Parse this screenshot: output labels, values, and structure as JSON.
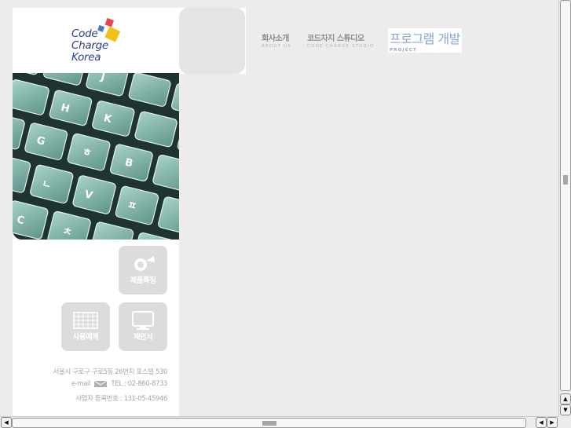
{
  "logo": {
    "lines": [
      "Code",
      "Charge",
      "Korea"
    ]
  },
  "nav": [
    {
      "ko": "회사소개",
      "en": "ABOUT US",
      "active": false
    },
    {
      "ko": "코드차지 스튜디오",
      "en": "CODE CHARGE STUDIO",
      "active": false
    },
    {
      "ko": "프로그램 개발",
      "en": "PROJECT",
      "active": true
    }
  ],
  "features": {
    "product": "제품특징",
    "examples": "사용예제",
    "proposal": "제안서"
  },
  "contact": {
    "address": "서울시 구로구 구로5동 26번지 포스빌 530",
    "email_label": "e-mail",
    "tel": "TEL : 02-860-8733",
    "business_no": "사업자 등록번호 : 131-05-45946"
  },
  "icons": {
    "product": "magnifier-icon",
    "examples": "grid-icon",
    "proposal": "monitor-icon",
    "email": "envelope-icon"
  },
  "colors": {
    "logo_text": "#2b3f8c",
    "logo_red": "#e8454e",
    "logo_yellow": "#f2c21b",
    "logo_blue": "#4a79c8",
    "nav_active": "#8da1d4",
    "keyboard_key": "#7fb5ab"
  }
}
